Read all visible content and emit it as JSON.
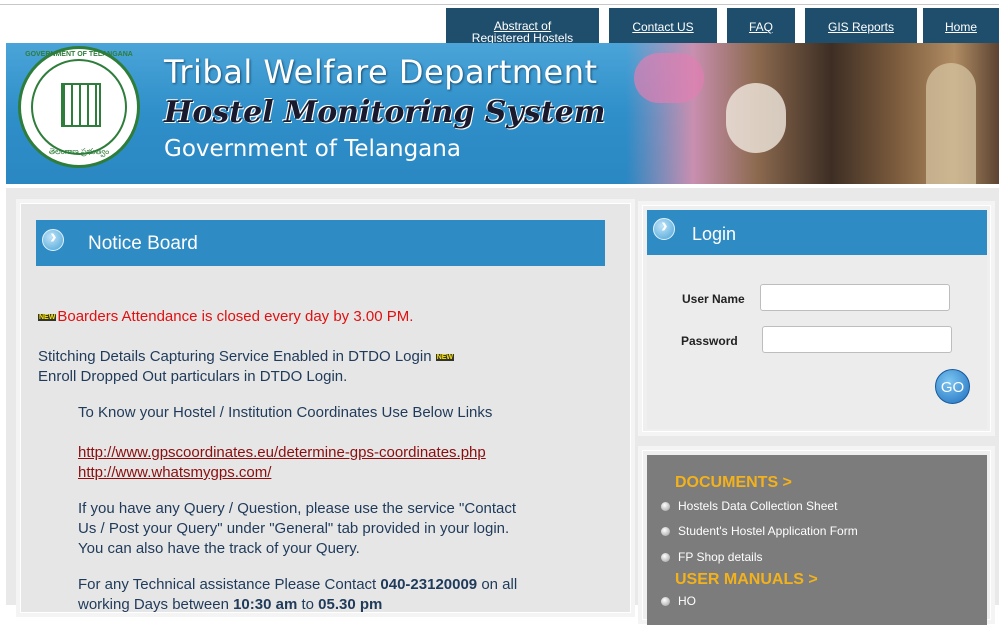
{
  "nav": {
    "abstract_line1": "Abstract of",
    "abstract_line2": "Registered Hostels",
    "contact": "Contact US",
    "faq": "FAQ",
    "gis": "GIS Reports",
    "home": "Home"
  },
  "banner": {
    "title1": "Tribal Welfare Department",
    "title2": "Hostel Monitoring System",
    "title3": "Government of Telangana",
    "seal_top": "GOVERNMENT OF TELANGANA",
    "seal_bottom": "తెలంగాణ ప్రభుత్వం"
  },
  "notice": {
    "title": "Notice Board",
    "new_badge": "NEW",
    "line1": "Boarders Attendance is closed every day by 3.00 PM.",
    "line2": "Stitching Details Capturing Service Enabled in DTDO Login",
    "line3": "Enroll Dropped Out particulars in DTDO Login.",
    "line4": "To Know your Hostel / Institution Coordinates Use Below Links",
    "link1": "http://www.gpscoordinates.eu/determine-gps-coordinates.php",
    "link2": "http://www.whatsmygps.com/",
    "query1": "If you have any Query / Question, please use the service \"Contact",
    "query2": "Us / Post your Query\" under \"General\" tab provided in your login.",
    "query3": "You can also have the track of your Query.",
    "tech_a": "For any Technical assistance Please Contact ",
    "tech_phone": "040-23120009",
    "tech_b": " on all",
    "tech2_a": "working Days between ",
    "tech2_time1": "10:30 am",
    "tech2_mid": " to ",
    "tech2_time2": "05.30 pm"
  },
  "login": {
    "title": "Login",
    "username_label": "User Name",
    "password_label": "Password",
    "username_value": "",
    "password_value": "",
    "go": "GO"
  },
  "documents": {
    "heading": "DOCUMENTS >",
    "items": [
      "Hostels Data Collection Sheet",
      "Student's Hostel Application Form",
      "FP Shop details"
    ],
    "manuals_heading": "USER MANUALS >",
    "manual_items": [
      "HO"
    ]
  },
  "colors": {
    "header_blue": "#2e8bc4",
    "nav_dark": "#1f4e6c",
    "notice_red": "#e01010",
    "doc_orange": "#f3b21b"
  }
}
